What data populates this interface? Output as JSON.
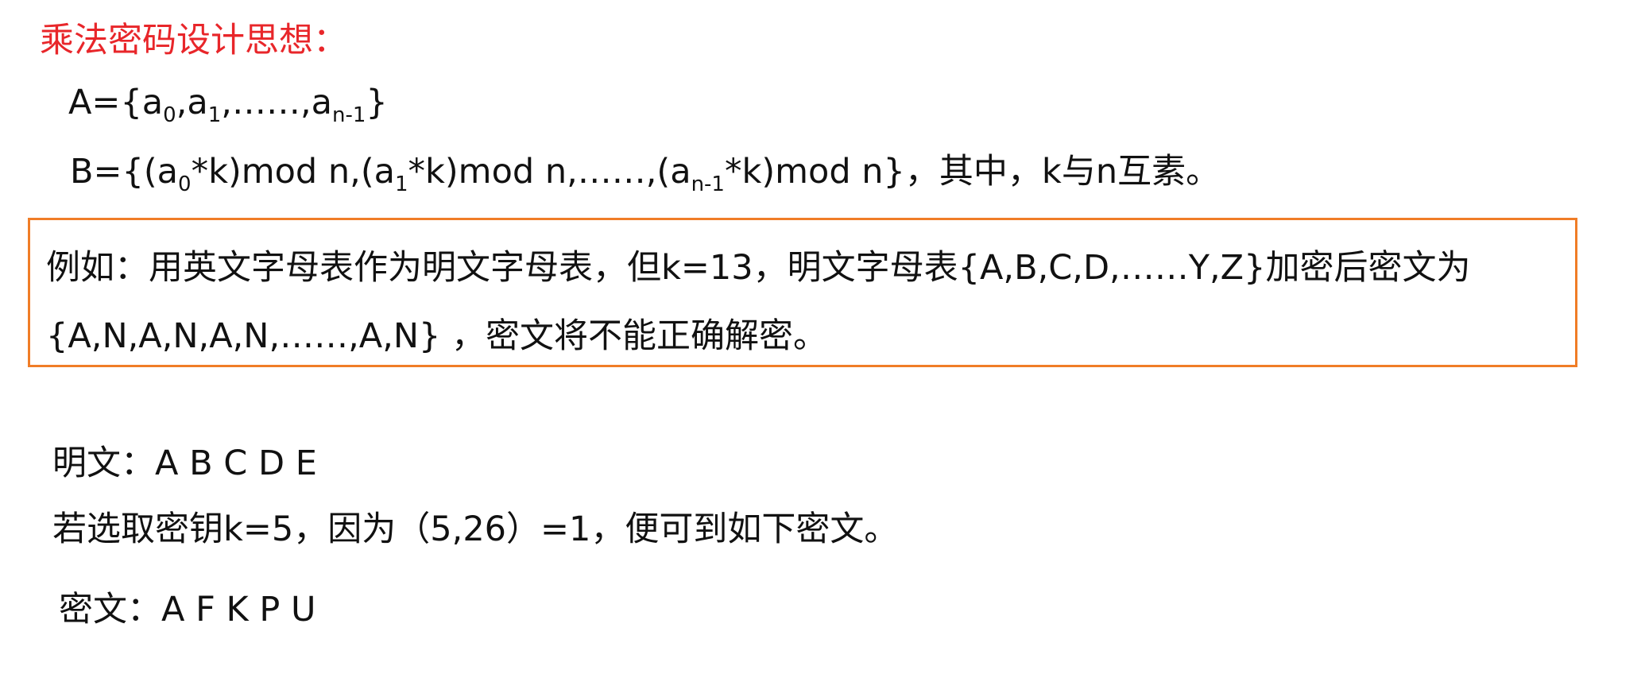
{
  "title": "乘法密码设计思想：",
  "set_a": {
    "p1": "A={a",
    "s1": "0",
    "p2": ",a",
    "s2": "1",
    "p3": ",……,a",
    "s3": "n-1",
    "p4": "}"
  },
  "set_b": {
    "p1": "B={(a",
    "s1": "0",
    "p2": "*k)mod n,(a",
    "s2": "1",
    "p3": "*k)mod n,……,(a",
    "s3": "n-1",
    "p4": "*k)mod n}，其中，k与n互素。"
  },
  "example": {
    "line1": "例如：用英文字母表作为明文字母表，但k=13，明文字母表{A,B,C,D,……Y,Z}加密后密文为",
    "line2": "{A,N,A,N,A,N,……,A,N} ，密文将不能正确解密。"
  },
  "plaintext": "明文：A  B  C  D  E",
  "key_line": "若选取密钥k=5，因为（5,26）=1，便可到如下密文。",
  "ciphertext": "密文：A  F  K  P  U"
}
